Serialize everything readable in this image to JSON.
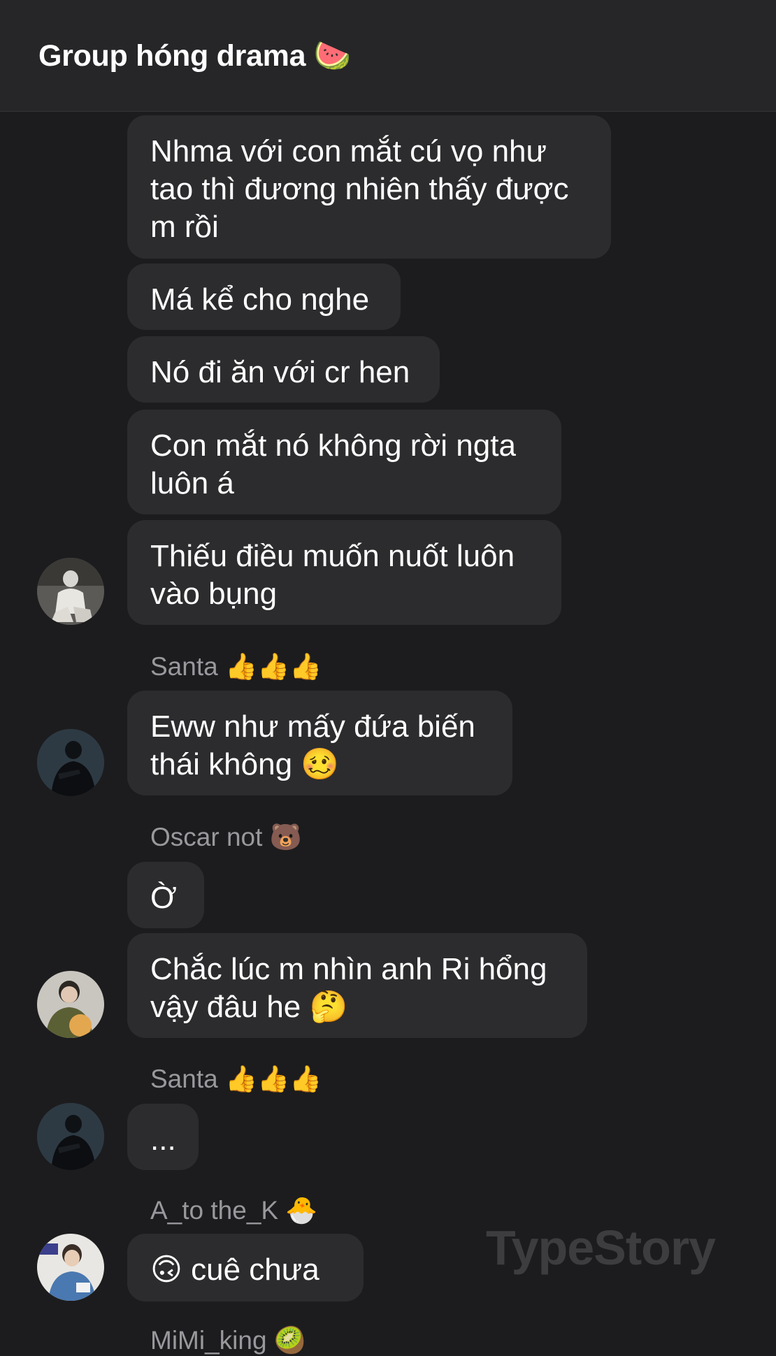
{
  "header": {
    "title": "Group hóng drama",
    "title_emoji": "🍉"
  },
  "messages": [
    {
      "id": "m1",
      "lines": [
        "Nhma với con mắt cú vọ như",
        "tao thì đương nhiên thấy được",
        "m rồi"
      ]
    },
    {
      "id": "m2",
      "lines": [
        "Má kể cho nghe"
      ]
    },
    {
      "id": "m3",
      "lines": [
        "Nó đi ăn với cr hen"
      ]
    },
    {
      "id": "m4",
      "lines": [
        "Con mắt nó không rời ngta",
        "luôn á"
      ]
    },
    {
      "id": "m5",
      "lines": [
        "Thiếu điều muốn nuốt luôn",
        "vào bụng"
      ]
    },
    {
      "id": "m6",
      "lines": [
        "Eww như mấy đứa biến",
        "thái không"
      ],
      "emoji": "🥴"
    },
    {
      "id": "m7",
      "lines": [
        "Ờ"
      ]
    },
    {
      "id": "m8",
      "lines": [
        "Chắc lúc m nhìn anh Ri hổng",
        "vậy đâu he"
      ],
      "emoji": "🤔"
    },
    {
      "id": "m9",
      "lines": [
        "..."
      ]
    },
    {
      "id": "m10",
      "lines": [
        "cuê chưa"
      ],
      "emoji_prefix": "🙃"
    }
  ],
  "senders": {
    "santa_1": {
      "name": "Santa",
      "emoji": "👍👍👍"
    },
    "oscar": {
      "name": "Oscar not",
      "emoji": "🐻"
    },
    "santa_2": {
      "name": "Santa",
      "emoji": "👍👍👍"
    },
    "atothek": {
      "name": "A_to the_K",
      "emoji": "🐣"
    },
    "mimi": {
      "name": "MiMi_king",
      "emoji": "🥝"
    }
  },
  "avatars": [
    {
      "id": "avatar-1",
      "desc_icon": "user-avatar-white-outfit"
    },
    {
      "id": "avatar-2",
      "desc_icon": "user-avatar-dark-jacket"
    },
    {
      "id": "avatar-3",
      "desc_icon": "user-avatar-green-hoodie"
    },
    {
      "id": "avatar-4",
      "desc_icon": "user-avatar-dark-jacket"
    },
    {
      "id": "avatar-5",
      "desc_icon": "user-avatar-blue-shirt"
    }
  ],
  "watermark": "TypeStory",
  "colors": {
    "background": "#1c1c1e",
    "header": "#262628",
    "bubble": "#2c2c2e",
    "text": "#ffffff",
    "sender": "#98989d"
  }
}
